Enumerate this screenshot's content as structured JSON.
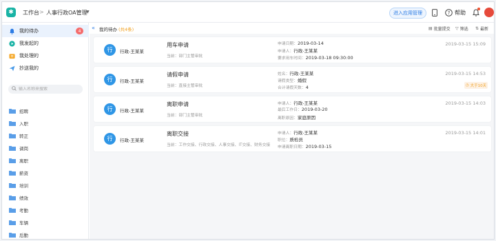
{
  "header": {
    "breadcrumb_root": "工作台",
    "breadcrumb_sep": ">",
    "breadcrumb_current": "人事行政OA管理",
    "enter_app_manage": "进入应用管理",
    "help_label": "帮助",
    "accent_color": "#2b7be4",
    "logo_color": "#19b3a5"
  },
  "sidebar": {
    "nav": [
      {
        "label": "我的待办",
        "icon": "bell-icon",
        "badge": "4"
      },
      {
        "label": "我发起的",
        "icon": "send-circle-icon"
      },
      {
        "label": "我处理的",
        "icon": "handled-box-icon"
      },
      {
        "label": "抄送我的",
        "icon": "paper-plane-icon"
      }
    ],
    "search_placeholder": "输入名称来搜索",
    "categories": [
      "招聘",
      "入职",
      "转正",
      "调岗",
      "离职",
      "薪资",
      "培训",
      "绩效",
      "考勤",
      "车辆",
      "后勤"
    ]
  },
  "main": {
    "title": "我的待办",
    "count_text": "(共4条)",
    "tools": {
      "batch": "批量提交",
      "filter": "筛选",
      "refresh": "最新"
    },
    "cards": [
      {
        "avatar": "行",
        "person": "行政-王某某",
        "title": "用车申请",
        "step": "当前：部门主管审批",
        "fields": [
          {
            "k": "申请日期：",
            "v": "2019-03-14"
          },
          {
            "k": "申请人：",
            "v": "行政-王某某"
          },
          {
            "k": "要求用车时间：",
            "v": "2019-03-18 09:30:00"
          }
        ],
        "time": "2019-03-15 15:09"
      },
      {
        "avatar": "行",
        "person": "行政-王某某",
        "title": "请假申请",
        "step": "当前：直接主管审批",
        "fields": [
          {
            "k": "姓名：",
            "v": "行政-王某某"
          },
          {
            "k": "请假类型：",
            "v": "婚假"
          },
          {
            "k": "合计请假天数：",
            "v": "4"
          }
        ],
        "time": "2019-03-15 14:53",
        "overdue": "大于10天"
      },
      {
        "avatar": "行",
        "person": "行政-王某某",
        "title": "离职申请",
        "step": "当前：部门主管审批",
        "fields": [
          {
            "k": "申请人：",
            "v": "行政-王某某"
          },
          {
            "k": "最后工作日：",
            "v": "2019-03-20"
          },
          {
            "k": "离职原因：",
            "v": "家庭原因"
          }
        ],
        "time": "2019-03-15 14:03"
      },
      {
        "avatar": "行",
        "person": "行政-王某某",
        "title": "离职交接",
        "step": "当前：工作交接、行政交接、人事交接、IT交接、财务交接",
        "fields": [
          {
            "k": "申请人：",
            "v": "行政-王某某"
          },
          {
            "k": "职位：",
            "v": "质检员"
          },
          {
            "k": "申请离职日期：",
            "v": "2019-03-15"
          }
        ],
        "time": "2019-03-15 14:01"
      }
    ]
  }
}
